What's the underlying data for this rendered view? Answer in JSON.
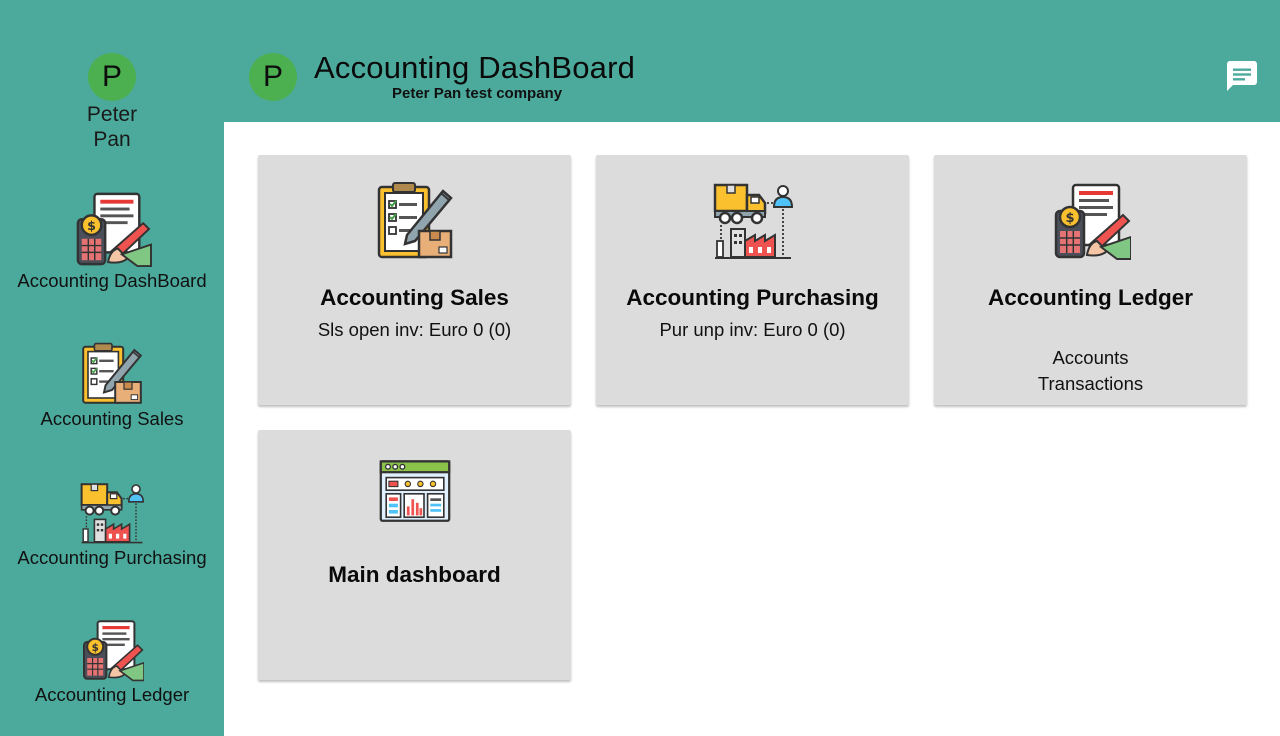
{
  "header": {
    "avatar_letter": "P",
    "title": "Accounting DashBoard",
    "subtitle": "Peter Pan test company",
    "chat_icon": "chat-icon"
  },
  "sidebar": {
    "avatar_letter": "P",
    "user_first": "Peter",
    "user_last": "Pan",
    "items": [
      {
        "label": "Accounting DashBoard",
        "icon": "ledger-calculator-icon"
      },
      {
        "label": "Accounting Sales",
        "icon": "clipboard-checklist-icon"
      },
      {
        "label": "Accounting Purchasing",
        "icon": "truck-factory-icon"
      },
      {
        "label": "Accounting Ledger",
        "icon": "ledger-calculator-icon"
      }
    ]
  },
  "cards": [
    {
      "title": "Accounting Sales",
      "subtitle": "Sls open inv: Euro 0 (0)",
      "icon": "clipboard-checklist-icon"
    },
    {
      "title": "Accounting Purchasing",
      "subtitle": "Pur unp inv: Euro 0 (0)",
      "icon": "truck-factory-icon"
    },
    {
      "title": "Accounting Ledger",
      "links": [
        "Accounts",
        "Transactions"
      ],
      "icon": "ledger-calculator-icon"
    },
    {
      "title": "Main dashboard",
      "icon": "dashboard-panel-icon"
    }
  ],
  "colors": {
    "teal": "#4caa9c",
    "avatar_green": "#4caf50",
    "card_bg": "#dcdcdc"
  }
}
